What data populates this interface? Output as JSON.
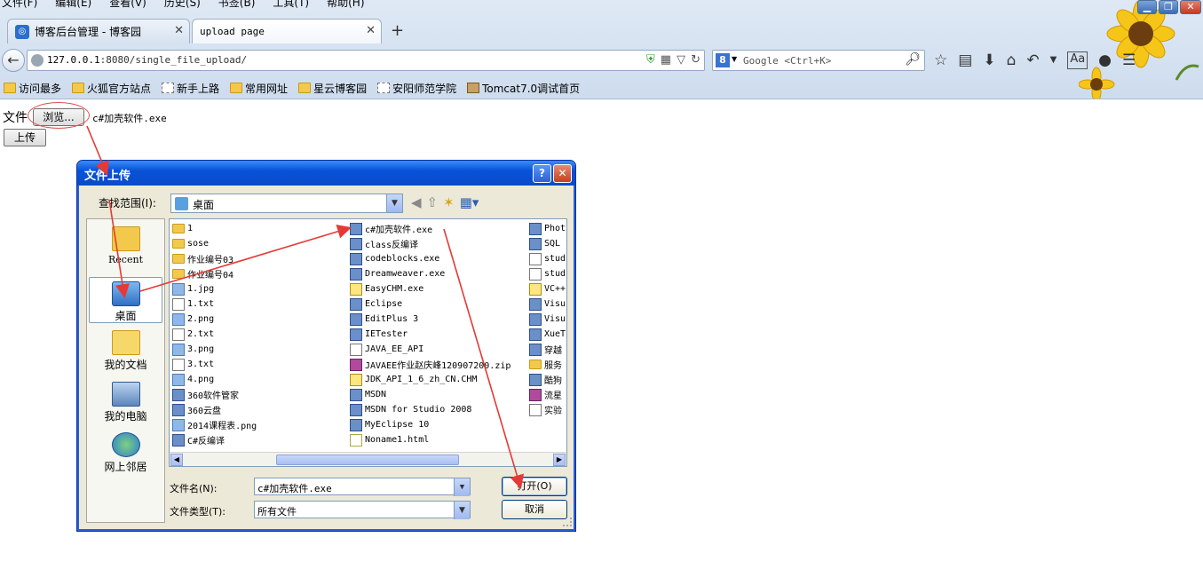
{
  "menu": [
    "文件(F)",
    "编辑(E)",
    "查看(V)",
    "历史(S)",
    "书签(B)",
    "工具(T)",
    "帮助(H)"
  ],
  "tabs": [
    {
      "label": "博客后台管理 - 博客园"
    },
    {
      "label": "upload page"
    }
  ],
  "address": {
    "host": "127.0.0.1",
    "path": ":8080/single_file_upload/"
  },
  "search": {
    "placeholder": "Google <Ctrl+K>"
  },
  "bookmarks": [
    "访问最多",
    "火狐官方站点",
    "新手上路",
    "常用网址",
    "星云博客园",
    "安阳师范学院",
    "Tomcat7.0调试首页"
  ],
  "page": {
    "file_label": "文件",
    "browse_label": "浏览...",
    "chosen_file": "c#加壳软件.exe",
    "upload_label": "上传"
  },
  "dialog": {
    "title": "文件上传",
    "lookin_label": "查找范围(I):",
    "lookin_value": "桌面",
    "places": [
      "Recent",
      "桌面",
      "我的文档",
      "我的电脑",
      "网上邻居"
    ],
    "columns": [
      [
        {
          "name": "1",
          "type": "folder"
        },
        {
          "name": "sose",
          "type": "folder"
        },
        {
          "name": "作业编号03",
          "type": "folder"
        },
        {
          "name": "作业编号04",
          "type": "folder"
        },
        {
          "name": "1.jpg",
          "type": "img"
        },
        {
          "name": "1.txt",
          "type": "txt"
        },
        {
          "name": "2.png",
          "type": "img"
        },
        {
          "name": "2.txt",
          "type": "txt"
        },
        {
          "name": "3.png",
          "type": "img"
        },
        {
          "name": "3.txt",
          "type": "txt"
        },
        {
          "name": "4.png",
          "type": "img"
        },
        {
          "name": "360软件管家",
          "type": "exe"
        },
        {
          "name": "360云盘",
          "type": "exe"
        },
        {
          "name": "2014课程表.png",
          "type": "img"
        },
        {
          "name": "C#反编译",
          "type": "exe"
        }
      ],
      [
        {
          "name": "c#加壳软件.exe",
          "type": "exe"
        },
        {
          "name": "class反编译",
          "type": "exe"
        },
        {
          "name": "codeblocks.exe",
          "type": "exe"
        },
        {
          "name": "Dreamweaver.exe",
          "type": "exe"
        },
        {
          "name": "EasyCHM.exe",
          "type": "chm"
        },
        {
          "name": "Eclipse",
          "type": "exe"
        },
        {
          "name": "EditPlus 3",
          "type": "exe"
        },
        {
          "name": "IETester",
          "type": "exe"
        },
        {
          "name": "JAVA_EE_API",
          "type": "txt"
        },
        {
          "name": "JAVAEE作业赵庆峰120907200.zip",
          "type": "zip"
        },
        {
          "name": "JDK_API_1_6_zh_CN.CHM",
          "type": "chm"
        },
        {
          "name": "MSDN",
          "type": "exe"
        },
        {
          "name": "MSDN for Studio 2008",
          "type": "exe"
        },
        {
          "name": "MyEclipse 10",
          "type": "exe"
        },
        {
          "name": "Noname1.html",
          "type": "html"
        }
      ],
      [
        {
          "name": "Phot",
          "type": "exe"
        },
        {
          "name": "SQL",
          "type": "exe"
        },
        {
          "name": "stud",
          "type": "txt"
        },
        {
          "name": "stud",
          "type": "txt"
        },
        {
          "name": "VC++",
          "type": "chm"
        },
        {
          "name": "Visu",
          "type": "exe"
        },
        {
          "name": "Visu",
          "type": "exe"
        },
        {
          "name": "XueT",
          "type": "exe"
        },
        {
          "name": "穿越",
          "type": "exe"
        },
        {
          "name": "服务",
          "type": "folder"
        },
        {
          "name": "酷狗",
          "type": "exe"
        },
        {
          "name": "流星",
          "type": "zip"
        },
        {
          "name": "实验",
          "type": "txt"
        }
      ]
    ],
    "filename_label": "文件名(N):",
    "filename_value": "c#加壳软件.exe",
    "filetype_label": "文件类型(T):",
    "filetype_value": "所有文件",
    "open_label": "打开(O)",
    "cancel_label": "取消"
  },
  "colors": {
    "annotation": "#e53935",
    "title_bar": "#0a4bc8",
    "accent": "#2a6fd0"
  }
}
